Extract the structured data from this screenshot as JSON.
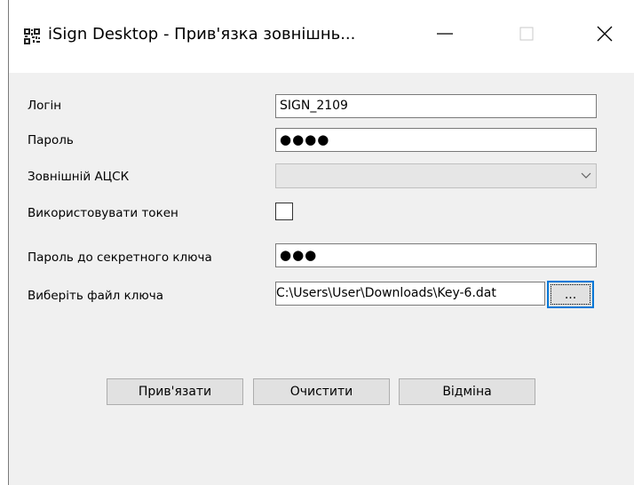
{
  "window": {
    "title": "iSign Desktop - Прив'язка зовнішнь...",
    "icon": "qr-app-icon"
  },
  "form": {
    "login_label": "Логін",
    "login_value": "SIGN_2109",
    "password_label": "Пароль",
    "password_value": "●●●●",
    "acsk_label": "Зовнішній АЦСК",
    "acsk_value": "",
    "token_label": "Використовувати токен",
    "token_checked": false,
    "key_password_label": "Пароль до секретного ключа",
    "key_password_value": "●●●",
    "key_file_label": "Виберіть файл ключа",
    "key_file_value": "C:\\Users\\User\\Downloads\\Key-6.dat",
    "browse_label": "..."
  },
  "buttons": {
    "bind": "Прив'язати",
    "clear": "Очистити",
    "cancel": "Відміна"
  },
  "colors": {
    "dialog_bg": "#f0f0f0",
    "titlebar_bg": "#ffffff",
    "button_bg": "#e1e1e1",
    "focus_accent": "#0078d7"
  }
}
